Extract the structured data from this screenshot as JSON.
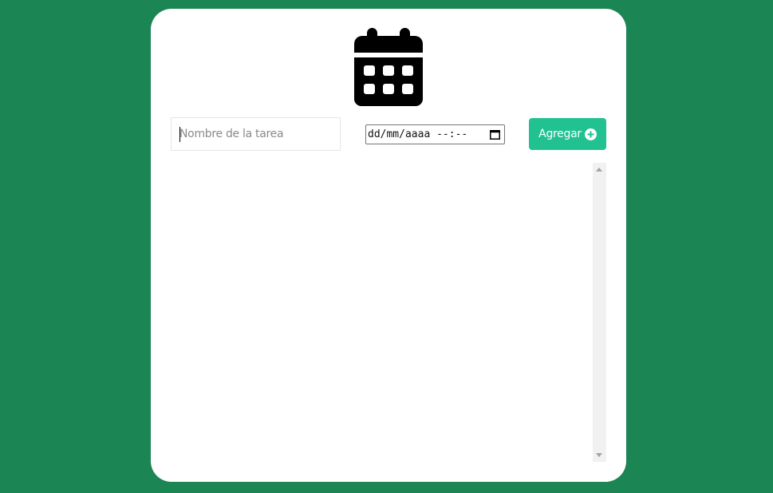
{
  "app": {
    "icon": "calendar-icon"
  },
  "form": {
    "task_placeholder": "Nombre de la tarea",
    "task_value": "",
    "date_value": "dd/mm/aaaa --:--",
    "add_label": "Agregar",
    "add_icon": "plus-circle-icon"
  },
  "tasks": [],
  "colors": {
    "background": "#1b8654",
    "card": "#ffffff",
    "accent": "#21c192"
  }
}
